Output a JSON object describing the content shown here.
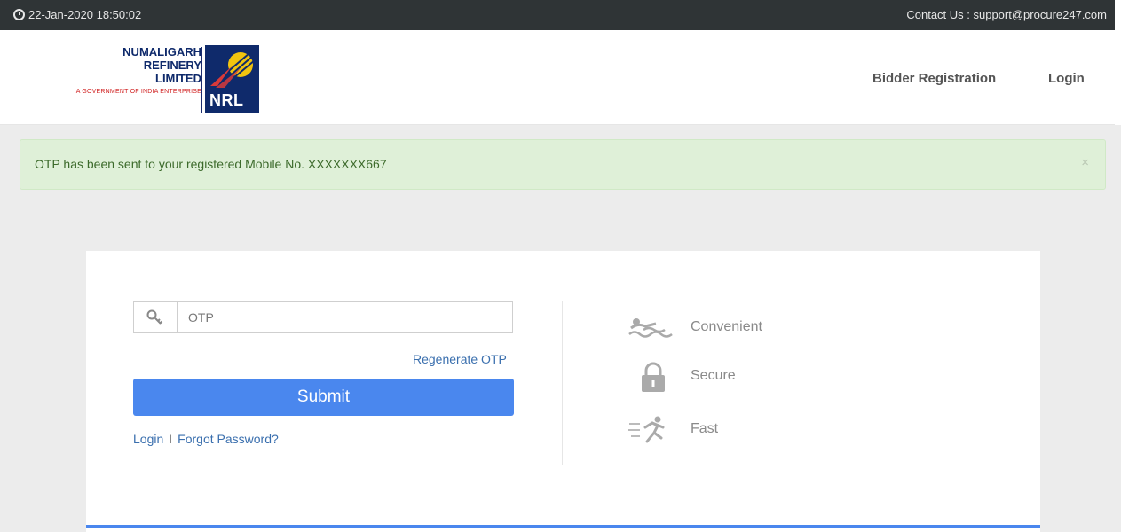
{
  "topbar": {
    "datetime": "22-Jan-2020 18:50:02",
    "contact": "Contact Us : support@procure247.com"
  },
  "logo": {
    "line1": "NUMALIGARH",
    "line2": "REFINERY",
    "line3": "LIMITED",
    "tagline": "A GOVERNMENT OF INDIA ENTERPRISE",
    "badge": "NRL"
  },
  "nav": {
    "bidder_registration": "Bidder Registration",
    "login": "Login"
  },
  "alert": {
    "message": "OTP has been sent to your registered Mobile No. XXXXXXX667",
    "close": "×"
  },
  "form": {
    "otp_placeholder": "OTP",
    "otp_value": "",
    "regenerate": "Regenerate OTP",
    "submit": "Submit",
    "login_link": "Login",
    "separator": "I",
    "forgot_link": "Forgot Password?"
  },
  "features": [
    {
      "label": "Convenient",
      "icon": "swimmer-icon"
    },
    {
      "label": "Secure",
      "icon": "lock-icon"
    },
    {
      "label": "Fast",
      "icon": "runner-icon"
    }
  ],
  "colors": {
    "topbar": "#2f3436",
    "accent": "#4a87ee",
    "alert_bg": "#dff0d8",
    "brand": "#0f2a6b"
  }
}
